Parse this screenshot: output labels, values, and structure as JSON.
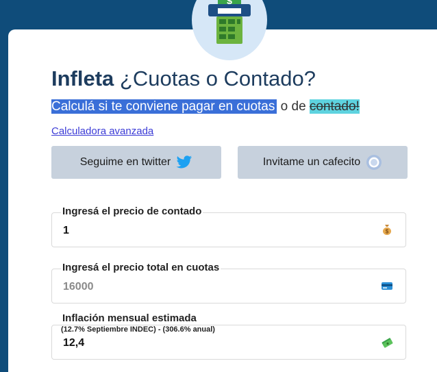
{
  "header": {
    "brand": "Infleta",
    "title_rest": "¿Cuotas o Contado?",
    "subtitle_highlight": "Calculá si te conviene pagar en cuotas",
    "subtitle_mid": " o de ",
    "subtitle_end": "contado!",
    "advanced_link": "Calculadora avanzada"
  },
  "buttons": {
    "twitter": "Seguime en twitter",
    "cafecito": "Invitame un cafecito"
  },
  "form": {
    "cash_price": {
      "label": "Ingresá el precio de contado",
      "value": "1",
      "icon": "money-bag-icon"
    },
    "installments_total": {
      "label": "Ingresá el precio total en cuotas",
      "placeholder": "16000",
      "icon": "credit-card-icon"
    },
    "inflation": {
      "label": "Inflación mensual estimada",
      "sublabel": "(12.7% Septiembre INDEC) - (306.6% anual)",
      "value": "12,4",
      "icon": "money-stack-icon"
    }
  },
  "colors": {
    "background": "#0f4c7a",
    "title": "#1d3c5e",
    "highlight": "#3a6fd8",
    "highlight_2": "#5ed3df",
    "button_bg": "#c7d1dd",
    "twitter_blue": "#1da1f2"
  }
}
